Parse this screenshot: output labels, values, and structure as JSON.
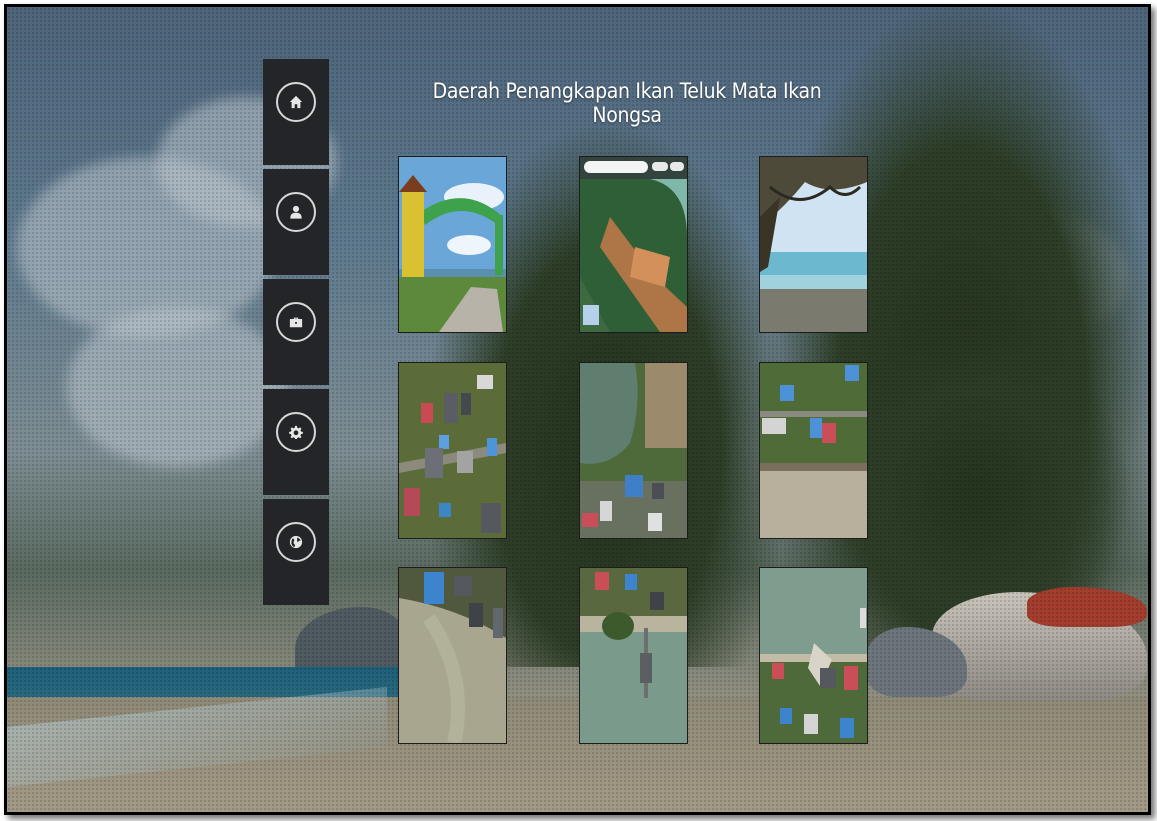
{
  "page": {
    "title": "Daerah Penangkapan Ikan Teluk Mata Ikan Nongsa"
  },
  "sidebar": {
    "items": [
      {
        "name": "home",
        "icon": "home-icon"
      },
      {
        "name": "profile",
        "icon": "user-icon"
      },
      {
        "name": "portfolio",
        "icon": "briefcase-icon"
      },
      {
        "name": "settings",
        "icon": "gear-icon"
      },
      {
        "name": "globe",
        "icon": "globe-icon"
      }
    ],
    "colors": {
      "background": "#232528",
      "icon": "#e6e6e6"
    }
  },
  "gallery": {
    "photos": [
      {
        "id": "gate-photo",
        "subject": "entrance arch gate"
      },
      {
        "id": "map-screenshot",
        "subject": "satellite map view"
      },
      {
        "id": "beach-tree-photo",
        "subject": "beach with tree"
      },
      {
        "id": "aerial-village-1",
        "subject": "aerial village roofs"
      },
      {
        "id": "aerial-pond",
        "subject": "aerial pond and houses"
      },
      {
        "id": "aerial-coast-1",
        "subject": "aerial coastline houses"
      },
      {
        "id": "aerial-shore-1",
        "subject": "aerial shoreline"
      },
      {
        "id": "aerial-pier",
        "subject": "aerial pier"
      },
      {
        "id": "aerial-coast-2",
        "subject": "aerial bay and houses"
      }
    ]
  },
  "colors": {
    "title": "#ffffff"
  }
}
